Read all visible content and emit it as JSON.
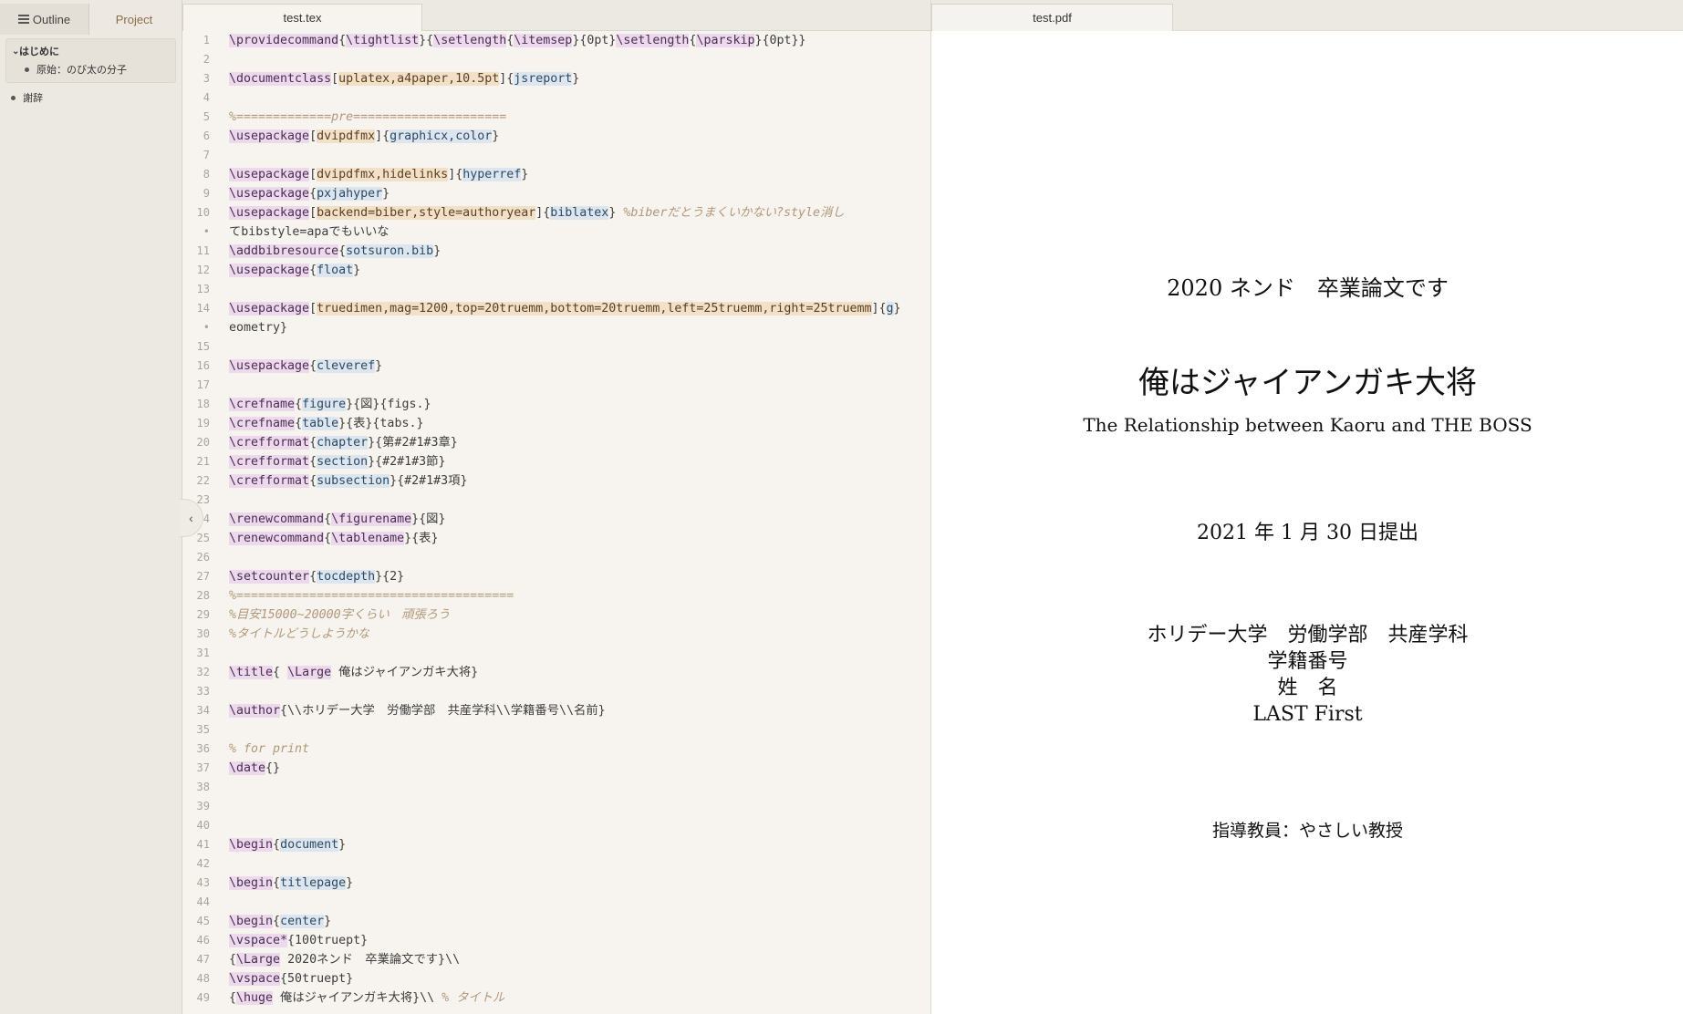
{
  "sidebar": {
    "tabs": {
      "outline": "Outline",
      "project": "Project"
    },
    "outline": {
      "section1": "はじめに",
      "section1_child": "原始：のび太の分子",
      "section2": "謝辞"
    }
  },
  "editor": {
    "tab_title": "test.tex",
    "lines": [
      {
        "n": "1",
        "t": "\\providecommand{\\tightlist}{\\setlength{\\itemsep}{0pt}\\setlength{\\parskip}{0pt}}"
      },
      {
        "n": "2",
        "t": ""
      },
      {
        "n": "3",
        "t": "\\documentclass[uplatex,a4paper,10.5pt]{jsreport}"
      },
      {
        "n": "4",
        "t": ""
      },
      {
        "n": "5",
        "t": "%=============pre====================="
      },
      {
        "n": "6",
        "t": "\\usepackage[dvipdfmx]{graphicx,color}"
      },
      {
        "n": "7",
        "t": ""
      },
      {
        "n": "8",
        "t": "\\usepackage[dvipdfmx,hidelinks]{hyperref}"
      },
      {
        "n": "9",
        "t": "\\usepackage{pxjahyper}"
      },
      {
        "n": "10",
        "t": "\\usepackage[backend=biber,style=authoryear]{biblatex} %biberだとうまくいかない?style消し"
      },
      {
        "n": "•",
        "t": "てbibstyle=apaでもいいな"
      },
      {
        "n": "11",
        "t": "\\addbibresource{sotsuron.bib}"
      },
      {
        "n": "12",
        "t": "\\usepackage{float}"
      },
      {
        "n": "13",
        "t": ""
      },
      {
        "n": "14",
        "t": "\\usepackage[truedimen,mag=1200,top=20truemm,bottom=20truemm,left=25truemm,right=25truemm]{g"
      },
      {
        "n": "•",
        "t": "eometry}"
      },
      {
        "n": "15",
        "t": ""
      },
      {
        "n": "16",
        "t": "\\usepackage{cleveref}"
      },
      {
        "n": "17",
        "t": ""
      },
      {
        "n": "18",
        "t": "\\crefname{figure}{図}{figs.}"
      },
      {
        "n": "19",
        "t": "\\crefname{table}{表}{tabs.}"
      },
      {
        "n": "20",
        "t": "\\crefformat{chapter}{第#2#1#3章}"
      },
      {
        "n": "21",
        "t": "\\crefformat{section}{#2#1#3節}"
      },
      {
        "n": "22",
        "t": "\\crefformat{subsection}{#2#1#3項}"
      },
      {
        "n": "23",
        "t": ""
      },
      {
        "n": "24",
        "t": "\\renewcommand{\\figurename}{図}"
      },
      {
        "n": "25",
        "t": "\\renewcommand{\\tablename}{表}"
      },
      {
        "n": "26",
        "t": ""
      },
      {
        "n": "27",
        "t": "\\setcounter{tocdepth}{2}"
      },
      {
        "n": "28",
        "t": "%======================================"
      },
      {
        "n": "29",
        "t": "%目安15000~20000字くらい　頑張ろう"
      },
      {
        "n": "30",
        "t": "%タイトルどうしようかな"
      },
      {
        "n": "31",
        "t": ""
      },
      {
        "n": "32",
        "t": "\\title{ \\Large 俺はジャイアンガキ大将}"
      },
      {
        "n": "33",
        "t": ""
      },
      {
        "n": "34",
        "t": "\\author{\\\\ホリデー大学　労働学部　共産学科\\\\学籍番号\\\\名前}"
      },
      {
        "n": "35",
        "t": ""
      },
      {
        "n": "36",
        "t": "% for print"
      },
      {
        "n": "37",
        "t": "\\date{}"
      },
      {
        "n": "38",
        "t": ""
      },
      {
        "n": "39",
        "t": ""
      },
      {
        "n": "40",
        "t": ""
      },
      {
        "n": "41",
        "t": "\\begin{document}"
      },
      {
        "n": "42",
        "t": ""
      },
      {
        "n": "43",
        "t": "\\begin{titlepage}"
      },
      {
        "n": "44",
        "t": ""
      },
      {
        "n": "45",
        "t": "\\begin{center}"
      },
      {
        "n": "46",
        "t": "\\vspace*{100truept}"
      },
      {
        "n": "47",
        "t": "{\\Large 2020ネンド　卒業論文です}\\\\"
      },
      {
        "n": "48",
        "t": "\\vspace{50truept}"
      },
      {
        "n": "49",
        "t": "{\\huge 俺はジャイアンガキ大将}\\\\ % タイトル"
      }
    ]
  },
  "viewer": {
    "tab_title": "test.pdf",
    "page": {
      "subtitle": "2020 ネンド　卒業論文です",
      "title": "俺はジャイアンガキ大将",
      "english_title": "The Relationship between Kaoru and THE BOSS",
      "date": "2021 年 1 月 30 日提出",
      "affiliation": "ホリデー大学　労働学部　共産学科",
      "student_id": "学籍番号",
      "name_jp": "姓　名",
      "name_en": "LAST First",
      "advisor": "指導教員：やさしい教授"
    }
  },
  "colors": {
    "command_bg": "#ecd9ec",
    "option_bg": "#f3e0c8",
    "argument_bg": "#dde6ee",
    "comment": "#b09878"
  }
}
